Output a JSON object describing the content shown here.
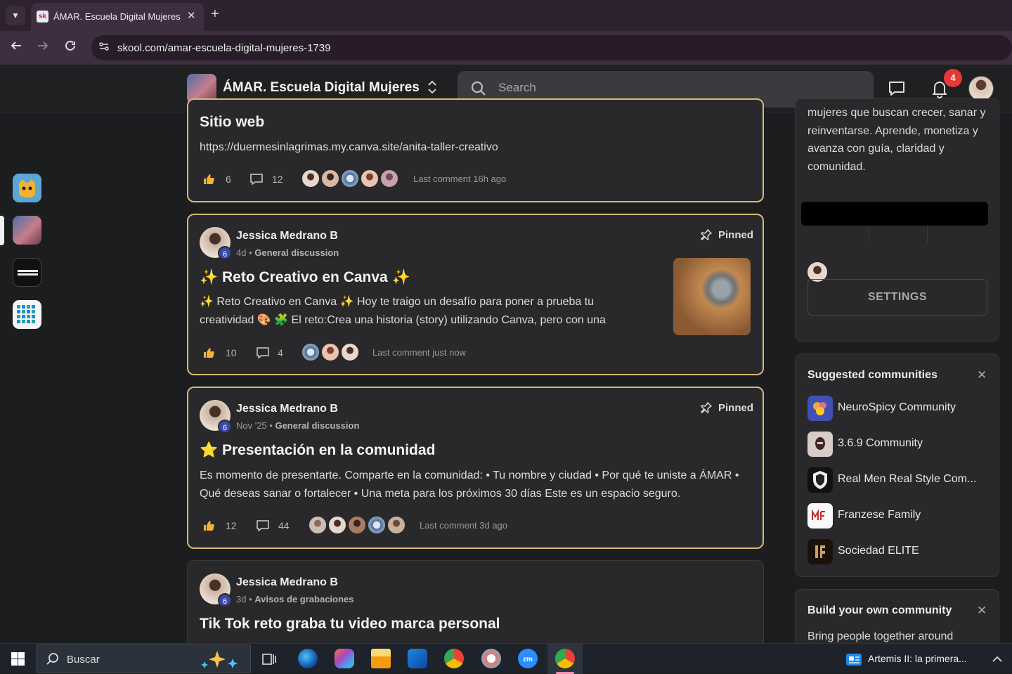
{
  "browser": {
    "tab_title": "ÁMAR. Escuela Digital Mujeres",
    "favicon_text": "sk",
    "url": "skool.com/amar-escuela-digital-mujeres-1739"
  },
  "header": {
    "group_name": "ÁMAR. Escuela Digital Mujeres",
    "search_placeholder": "Search",
    "notification_count": "4"
  },
  "posts": [
    {
      "title": "Sitio web",
      "body": "https://duermesinlagrimas.my.canva.site/anita-taller-creativo",
      "likes": "6",
      "comments": "12",
      "last_comment": "Last comment 16h ago"
    },
    {
      "author": "Jessica Medrano B",
      "level": "6",
      "time": "4d",
      "category": "General discussion",
      "pinned": "Pinned",
      "title": "✨ Reto Creativo en Canva ✨",
      "body": "✨ Reto Creativo en Canva ✨ Hoy te traigo un desafío para poner a prueba tu creatividad 🎨 🧩 El reto:Crea una historia (story) utilizando Canva, pero con una",
      "likes": "10",
      "comments": "4",
      "last_comment": "Last comment just now"
    },
    {
      "author": "Jessica Medrano B",
      "level": "6",
      "time": "Nov '25",
      "category": "General discussion",
      "pinned": "Pinned",
      "title": "⭐ Presentación en la comunidad",
      "body": "Es momento de presentarte. Comparte en la comunidad: • Tu nombre y ciudad • Por qué te uniste a ÁMAR • Qué deseas sanar o fortalecer • Una meta para los próximos 30 días Este es un espacio seguro.",
      "likes": "12",
      "comments": "44",
      "last_comment": "Last comment 3d ago"
    },
    {
      "author": "Jessica Medrano B",
      "level": "6",
      "time": "3d",
      "category": "Avisos de grabaciones",
      "title": "Tik Tok reto graba tu video marca personal"
    }
  ],
  "sidebar": {
    "about_text": "mujeres que buscan crecer, sanar y reinventarse. Aprende, monetiza y avanza con guía, claridad y comunidad.",
    "settings_label": "SETTINGS",
    "suggested_title": "Suggested communities",
    "communities": [
      {
        "name": "NeuroSpicy Community"
      },
      {
        "name": "3.6.9 Community"
      },
      {
        "name": "Real Men Real Style Com..."
      },
      {
        "name": "Franzese Family"
      },
      {
        "name": "Sociedad ELITE"
      }
    ],
    "build_title": "Build your own community",
    "build_text": "Bring people together around"
  },
  "taskbar": {
    "search_text": "Buscar",
    "notification_text": "Artemis II: la primera..."
  },
  "colors": {
    "pinned_border": "#d9b878",
    "level_badge": "#3949ab",
    "notif_badge": "#e53935",
    "card_bg": "#29292b"
  }
}
